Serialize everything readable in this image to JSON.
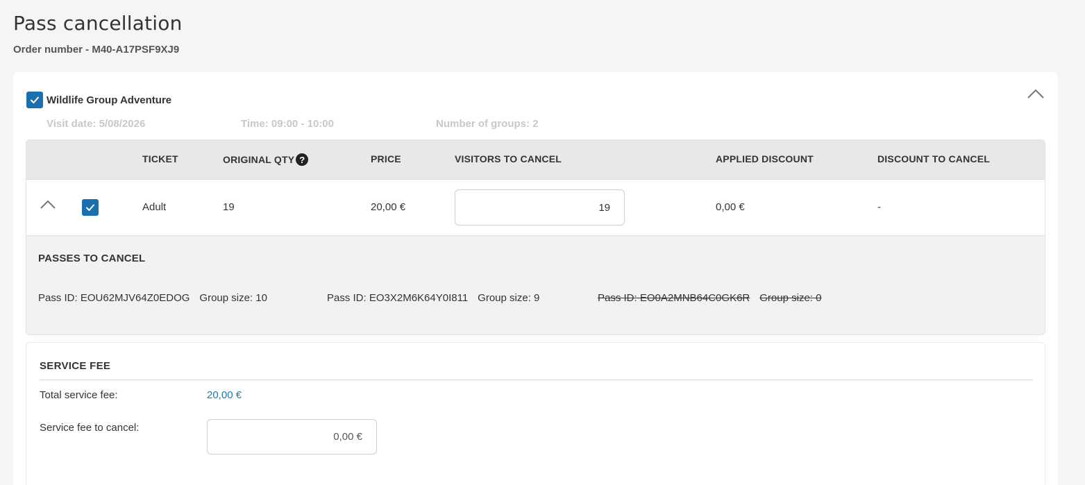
{
  "header": {
    "title": "Pass cancellation",
    "order_number": "Order number - M40-A17PSF9XJ9"
  },
  "product": {
    "name": "Wildlife Group Adventure",
    "checked": true,
    "visit_date": "Visit date: 5/08/2026",
    "time": "Time: 09:00 - 10:00",
    "groups": "Number of groups: 2"
  },
  "table": {
    "headers": {
      "ticket": "TICKET",
      "original_qty": "ORIGINAL QTY",
      "price": "PRICE",
      "visitors_to_cancel": "VISITORS TO CANCEL",
      "applied_discount": "APPLIED DISCOUNT",
      "discount_to_cancel": "DISCOUNT TO CANCEL"
    },
    "help_icon_glyph": "?",
    "rows": [
      {
        "ticket": "Adult",
        "original_qty": "19",
        "price": "20,00 €",
        "visitors_to_cancel": "19",
        "applied_discount": "0,00 €",
        "discount_to_cancel": "-",
        "checked": true
      }
    ]
  },
  "passes": {
    "title": "PASSES TO CANCEL",
    "items": [
      {
        "pass_id": "Pass ID: EOU62MJV64Z0EDOG",
        "group_size": "Group size: 10",
        "struck": false
      },
      {
        "pass_id": "Pass ID: EO3X2M6K64Y0I811",
        "group_size": "Group size: 9",
        "struck": false
      },
      {
        "pass_id": "Pass ID: EO0A2MNB64C0GK6R",
        "group_size": "Group size: 0",
        "struck": true
      }
    ]
  },
  "service_fee": {
    "title": "SERVICE FEE",
    "total_label": "Total service fee:",
    "total_value": "20,00 €",
    "cancel_label": "Service fee to cancel:",
    "cancel_value": "0,00 €"
  },
  "colors": {
    "accent": "#1a6fae",
    "link": "#1a78b5",
    "muted": "#c8c8c8"
  }
}
